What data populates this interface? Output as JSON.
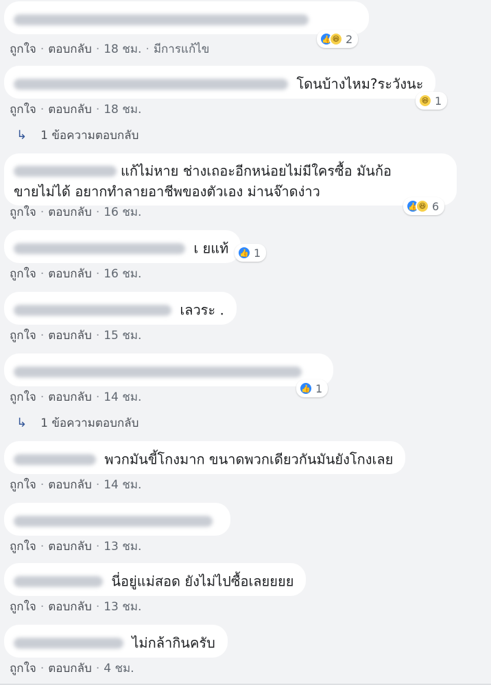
{
  "labels": {
    "like": "ถูกใจ",
    "reply": "ตอบกลับ",
    "edited": "มีการแก้ไข"
  },
  "comments": [
    {
      "text": "",
      "time": "18 ชม.",
      "reaction_count": "2"
    },
    {
      "text": "โดนบ้างไหม?ระวังนะ",
      "time": "18 ชม.",
      "reaction_count": "1"
    },
    {
      "text_line1": "แก้ไม่หาย ช่างเถอะอีกหน่อยไม่มีใครซื้อ มันก้อ",
      "text_line2": "ขายไม่ได้ อยากทำลายอาชีพของตัวเอง ม่านจ๊าดง่าว",
      "time": "16 ชม.",
      "reaction_count": "6"
    },
    {
      "text": "เ ยแท้",
      "time": "16 ชม.",
      "reaction_count": "1"
    },
    {
      "text": "เลวระ .",
      "time": "15 ชม."
    },
    {
      "text": "",
      "time": "14 ชม.",
      "reaction_count": "1"
    },
    {
      "text": "พวกมันขี้โกงมาก ขนาดพวกเดียวกันมันยังโกงเลย",
      "time": "14 ชม."
    },
    {
      "text": "",
      "time": "13 ชม."
    },
    {
      "text": "นี่อยู่แม่สอด ยังไม่ไปซื้อเลยยยย",
      "time": "13 ชม."
    },
    {
      "text": "ไม่กล้ากินครับ",
      "time": "4 ชม."
    }
  ],
  "replies_label": "1 ข้อความตอบกลับ",
  "icons": {
    "like": "like-icon",
    "haha": "haha-icon",
    "reply_arrow": "reply-arrow-icon"
  },
  "colors": {
    "like_blue": "#2d88ff",
    "haha_yellow": "#f7d04a",
    "background": "#f2f3f5"
  }
}
